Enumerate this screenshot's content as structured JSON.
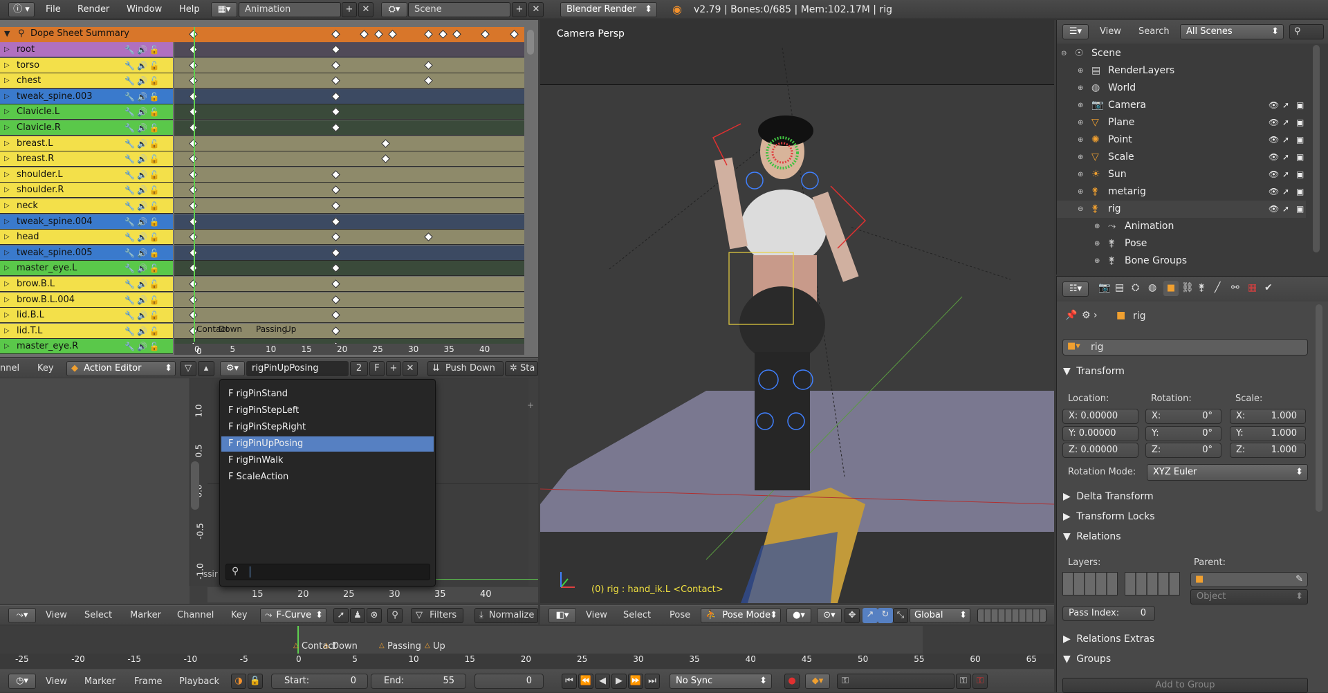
{
  "topbar": {
    "menus": [
      "File",
      "Render",
      "Window",
      "Help"
    ],
    "screen_layout": "Animation",
    "scene": "Scene",
    "render_engine": "Blender Render",
    "stats": "v2.79 | Bones:0/685  | Mem:102.17M | rig"
  },
  "dopesheet": {
    "summary_label": "Dope Sheet Summary",
    "channels": [
      {
        "name": "root",
        "color": "#b070c0"
      },
      {
        "name": "torso",
        "color": "#f3e04a"
      },
      {
        "name": "chest",
        "color": "#f3e04a"
      },
      {
        "name": "tweak_spine.003",
        "color": "#3a7acc"
      },
      {
        "name": "Clavicle.L",
        "color": "#5ac84a"
      },
      {
        "name": "Clavicle.R",
        "color": "#5ac84a"
      },
      {
        "name": "breast.L",
        "color": "#f3e04a"
      },
      {
        "name": "breast.R",
        "color": "#f3e04a"
      },
      {
        "name": "shoulder.L",
        "color": "#f3e04a"
      },
      {
        "name": "shoulder.R",
        "color": "#f3e04a"
      },
      {
        "name": "neck",
        "color": "#f3e04a"
      },
      {
        "name": "tweak_spine.004",
        "color": "#3a7acc"
      },
      {
        "name": "head",
        "color": "#f3e04a"
      },
      {
        "name": "tweak_spine.005",
        "color": "#3a7acc"
      },
      {
        "name": "master_eye.L",
        "color": "#5ac84a"
      },
      {
        "name": "brow.B.L",
        "color": "#f3e04a"
      },
      {
        "name": "brow.B.L.004",
        "color": "#f3e04a"
      },
      {
        "name": "lid.B.L",
        "color": "#f3e04a"
      },
      {
        "name": "lid.T.L",
        "color": "#f3e04a"
      },
      {
        "name": "master_eye.R",
        "color": "#5ac84a"
      }
    ],
    "markers": [
      "Contact",
      "Down",
      "Passing",
      "Up"
    ],
    "timeline_ticks": [
      "0",
      "5",
      "10",
      "15",
      "20",
      "25",
      "30",
      "35",
      "40"
    ],
    "header": {
      "left_label": "nnel",
      "key_menu": "Key",
      "mode": "Action Editor",
      "action_name": "rigPinUpPosing",
      "users": "2",
      "fake_user": "F",
      "push_down": "Push Down",
      "stash": "Sta"
    }
  },
  "action_dropdown": {
    "items": [
      "F rigPinStand",
      "F rigPinStepLeft",
      "F rigPinStepRight",
      "F rigPinUpPosing",
      "F rigPinWalk",
      "F ScaleAction"
    ],
    "selected": 3,
    "search_value": ""
  },
  "graph_editor": {
    "y_ticks": [
      "1.0",
      "0.5",
      "0.0",
      "-0.5",
      "-1.0"
    ],
    "x_ticks": [
      "15",
      "20",
      "25",
      "30",
      "35",
      "40"
    ],
    "partial_label": "ssir",
    "header": {
      "menus": [
        "View",
        "Select",
        "Marker",
        "Channel",
        "Key"
      ],
      "mode": "F-Curve",
      "filters": "Filters",
      "normalize": "Normalize"
    }
  },
  "viewport": {
    "label": "Camera Persp",
    "status": "(0) rig : hand_ik.L <Contact>",
    "header": {
      "menus": [
        "View",
        "Select",
        "Pose"
      ],
      "mode": "Pose Mode",
      "orientation": "Global"
    }
  },
  "timeline": {
    "ticks": [
      "-25",
      "-20",
      "-15",
      "-10",
      "-5",
      "0",
      "5",
      "10",
      "15",
      "20",
      "25",
      "30",
      "35",
      "40",
      "45",
      "50",
      "55",
      "60",
      "65"
    ],
    "markers": [
      "Contact",
      "Down",
      "Passing",
      "Up"
    ],
    "menus": [
      "View",
      "Marker",
      "Frame",
      "Playback"
    ],
    "start_label": "Start:",
    "start": "0",
    "end_label": "End:",
    "end": "55",
    "current": "0",
    "sync": "No Sync"
  },
  "outliner": {
    "menus": [
      "View",
      "Search"
    ],
    "filter": "All Scenes",
    "items": [
      {
        "name": "Scene",
        "indent": 0
      },
      {
        "name": "RenderLayers",
        "indent": 1
      },
      {
        "name": "World",
        "indent": 1
      },
      {
        "name": "Camera",
        "indent": 1
      },
      {
        "name": "Plane",
        "indent": 1
      },
      {
        "name": "Point",
        "indent": 1
      },
      {
        "name": "Scale",
        "indent": 1
      },
      {
        "name": "Sun",
        "indent": 1
      },
      {
        "name": "metarig",
        "indent": 1
      },
      {
        "name": "rig",
        "indent": 1
      },
      {
        "name": "Animation",
        "indent": 2
      },
      {
        "name": "Pose",
        "indent": 2
      },
      {
        "name": "Bone Groups",
        "indent": 2
      }
    ]
  },
  "properties": {
    "context_name": "rig",
    "object_name": "rig",
    "transform": {
      "title": "Transform",
      "location_label": "Location:",
      "rotation_label": "Rotation:",
      "scale_label": "Scale:",
      "location": [
        "X: 0.00000",
        "Y: 0.00000",
        "Z: 0.00000"
      ],
      "rotation_axes": [
        "X:",
        "Y:",
        "Z:"
      ],
      "rotation_values": [
        "0°",
        "0°",
        "0°"
      ],
      "scale_axes": [
        "X:",
        "Y:",
        "Z:"
      ],
      "scale_values": [
        "1.000",
        "1.000",
        "1.000"
      ],
      "rotation_mode_label": "Rotation Mode:",
      "rotation_mode": "XYZ Euler"
    },
    "panels": {
      "delta": "Delta Transform",
      "locks": "Transform Locks",
      "relations": "Relations",
      "layers_label": "Layers:",
      "parent_label": "Parent:",
      "parent_type": "Object",
      "pass_index_label": "Pass Index:",
      "pass_index": "0",
      "relations_extras": "Relations Extras",
      "groups": "Groups",
      "add_to_group": "Add to Group"
    }
  }
}
